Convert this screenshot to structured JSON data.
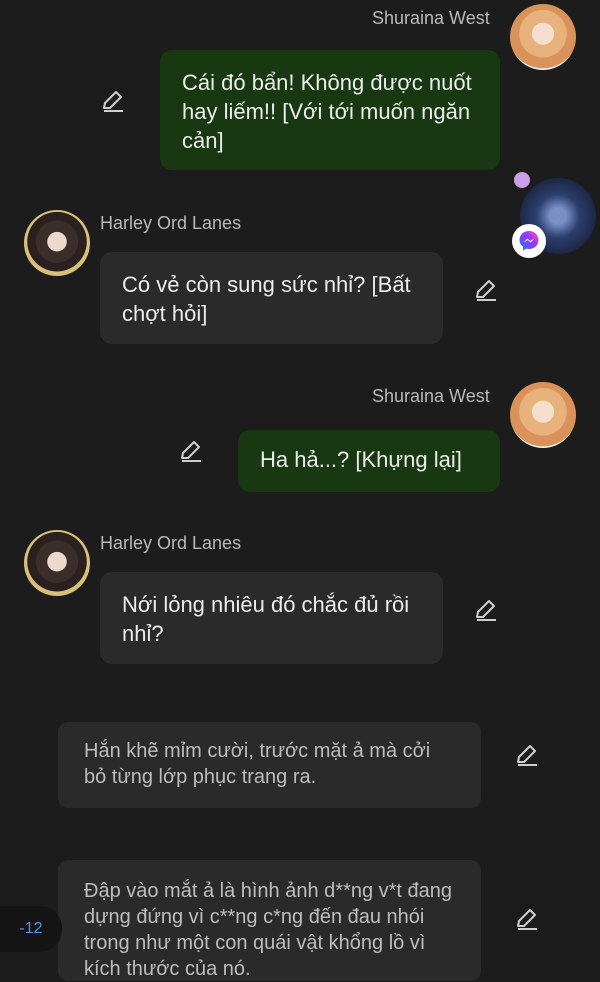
{
  "messages": [
    {
      "sender": "Shuraina West",
      "text": "Cái đó bẩn! Không được nuốt hay liếm!! [Với tới muốn ngăn cản]"
    },
    {
      "sender": "Harley Ord Lanes",
      "text": "Có vẻ còn sung sức nhỉ? [Bất chợt hỏi]"
    },
    {
      "sender": "Shuraina West",
      "text": "Ha hả...? [Khựng lại]"
    },
    {
      "sender": "Harley Ord Lanes",
      "text": "Nới lỏng nhiêu đó chắc đủ rồi nhỉ?"
    }
  ],
  "narrations": [
    {
      "text": "Hắn khẽ mỉm cười, trước mặt ả mà cởi bỏ từng lớp phục trang ra."
    },
    {
      "text": "Đập vào mắt ả là hình ảnh d**ng v*t đang dựng đứng vì c**ng c*ng đến đau nhói trong như một con quái vật khổng lồ vì kích thước của nó."
    }
  ],
  "badge": {
    "value": "-12"
  },
  "icons": {
    "edit": "pencil-edit-icon",
    "chat_head": "messenger-icon"
  },
  "colors": {
    "green_bubble": "#173810",
    "dark_bubble": "#2a2a2a",
    "background": "#1c1c1c",
    "badge_text": "#5d8ee6"
  }
}
